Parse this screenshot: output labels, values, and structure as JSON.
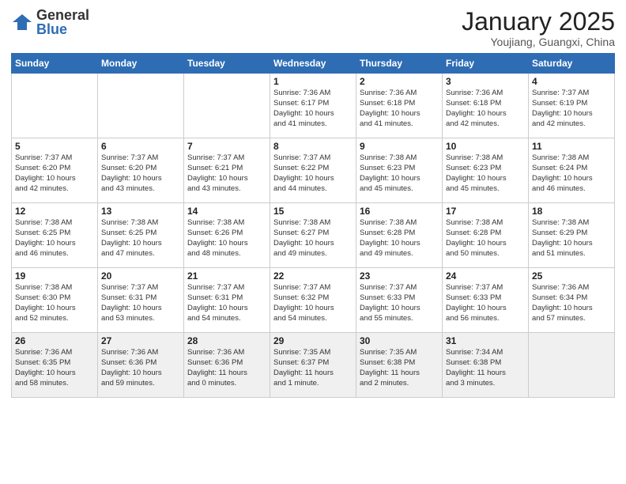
{
  "logo": {
    "general": "General",
    "blue": "Blue"
  },
  "header": {
    "month": "January 2025",
    "location": "Youjiang, Guangxi, China"
  },
  "weekdays": [
    "Sunday",
    "Monday",
    "Tuesday",
    "Wednesday",
    "Thursday",
    "Friday",
    "Saturday"
  ],
  "weeks": [
    [
      {
        "day": "",
        "info": ""
      },
      {
        "day": "",
        "info": ""
      },
      {
        "day": "",
        "info": ""
      },
      {
        "day": "1",
        "info": "Sunrise: 7:36 AM\nSunset: 6:17 PM\nDaylight: 10 hours\nand 41 minutes."
      },
      {
        "day": "2",
        "info": "Sunrise: 7:36 AM\nSunset: 6:18 PM\nDaylight: 10 hours\nand 41 minutes."
      },
      {
        "day": "3",
        "info": "Sunrise: 7:36 AM\nSunset: 6:18 PM\nDaylight: 10 hours\nand 42 minutes."
      },
      {
        "day": "4",
        "info": "Sunrise: 7:37 AM\nSunset: 6:19 PM\nDaylight: 10 hours\nand 42 minutes."
      }
    ],
    [
      {
        "day": "5",
        "info": "Sunrise: 7:37 AM\nSunset: 6:20 PM\nDaylight: 10 hours\nand 42 minutes."
      },
      {
        "day": "6",
        "info": "Sunrise: 7:37 AM\nSunset: 6:20 PM\nDaylight: 10 hours\nand 43 minutes."
      },
      {
        "day": "7",
        "info": "Sunrise: 7:37 AM\nSunset: 6:21 PM\nDaylight: 10 hours\nand 43 minutes."
      },
      {
        "day": "8",
        "info": "Sunrise: 7:37 AM\nSunset: 6:22 PM\nDaylight: 10 hours\nand 44 minutes."
      },
      {
        "day": "9",
        "info": "Sunrise: 7:38 AM\nSunset: 6:23 PM\nDaylight: 10 hours\nand 45 minutes."
      },
      {
        "day": "10",
        "info": "Sunrise: 7:38 AM\nSunset: 6:23 PM\nDaylight: 10 hours\nand 45 minutes."
      },
      {
        "day": "11",
        "info": "Sunrise: 7:38 AM\nSunset: 6:24 PM\nDaylight: 10 hours\nand 46 minutes."
      }
    ],
    [
      {
        "day": "12",
        "info": "Sunrise: 7:38 AM\nSunset: 6:25 PM\nDaylight: 10 hours\nand 46 minutes."
      },
      {
        "day": "13",
        "info": "Sunrise: 7:38 AM\nSunset: 6:25 PM\nDaylight: 10 hours\nand 47 minutes."
      },
      {
        "day": "14",
        "info": "Sunrise: 7:38 AM\nSunset: 6:26 PM\nDaylight: 10 hours\nand 48 minutes."
      },
      {
        "day": "15",
        "info": "Sunrise: 7:38 AM\nSunset: 6:27 PM\nDaylight: 10 hours\nand 49 minutes."
      },
      {
        "day": "16",
        "info": "Sunrise: 7:38 AM\nSunset: 6:28 PM\nDaylight: 10 hours\nand 49 minutes."
      },
      {
        "day": "17",
        "info": "Sunrise: 7:38 AM\nSunset: 6:28 PM\nDaylight: 10 hours\nand 50 minutes."
      },
      {
        "day": "18",
        "info": "Sunrise: 7:38 AM\nSunset: 6:29 PM\nDaylight: 10 hours\nand 51 minutes."
      }
    ],
    [
      {
        "day": "19",
        "info": "Sunrise: 7:38 AM\nSunset: 6:30 PM\nDaylight: 10 hours\nand 52 minutes."
      },
      {
        "day": "20",
        "info": "Sunrise: 7:37 AM\nSunset: 6:31 PM\nDaylight: 10 hours\nand 53 minutes."
      },
      {
        "day": "21",
        "info": "Sunrise: 7:37 AM\nSunset: 6:31 PM\nDaylight: 10 hours\nand 54 minutes."
      },
      {
        "day": "22",
        "info": "Sunrise: 7:37 AM\nSunset: 6:32 PM\nDaylight: 10 hours\nand 54 minutes."
      },
      {
        "day": "23",
        "info": "Sunrise: 7:37 AM\nSunset: 6:33 PM\nDaylight: 10 hours\nand 55 minutes."
      },
      {
        "day": "24",
        "info": "Sunrise: 7:37 AM\nSunset: 6:33 PM\nDaylight: 10 hours\nand 56 minutes."
      },
      {
        "day": "25",
        "info": "Sunrise: 7:36 AM\nSunset: 6:34 PM\nDaylight: 10 hours\nand 57 minutes."
      }
    ],
    [
      {
        "day": "26",
        "info": "Sunrise: 7:36 AM\nSunset: 6:35 PM\nDaylight: 10 hours\nand 58 minutes."
      },
      {
        "day": "27",
        "info": "Sunrise: 7:36 AM\nSunset: 6:36 PM\nDaylight: 10 hours\nand 59 minutes."
      },
      {
        "day": "28",
        "info": "Sunrise: 7:36 AM\nSunset: 6:36 PM\nDaylight: 11 hours\nand 0 minutes."
      },
      {
        "day": "29",
        "info": "Sunrise: 7:35 AM\nSunset: 6:37 PM\nDaylight: 11 hours\nand 1 minute."
      },
      {
        "day": "30",
        "info": "Sunrise: 7:35 AM\nSunset: 6:38 PM\nDaylight: 11 hours\nand 2 minutes."
      },
      {
        "day": "31",
        "info": "Sunrise: 7:34 AM\nSunset: 6:38 PM\nDaylight: 11 hours\nand 3 minutes."
      },
      {
        "day": "",
        "info": ""
      }
    ]
  ]
}
